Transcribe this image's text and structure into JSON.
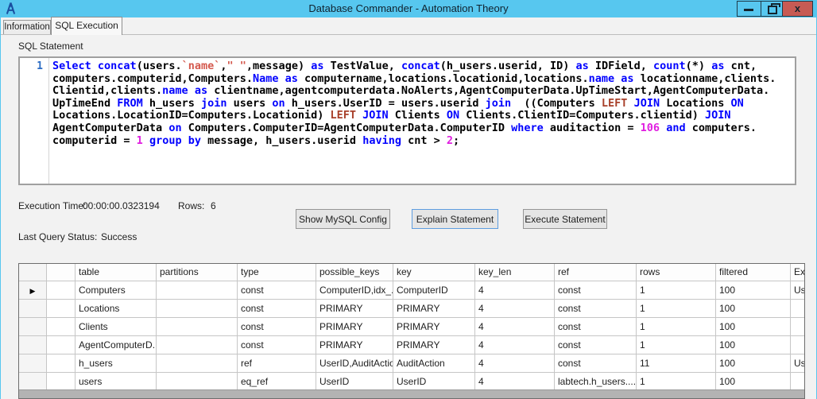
{
  "colors": {
    "titlebar": "#57c7ef",
    "close_button": "#c75b54",
    "keyword": "#0000ff",
    "string": "#d4594e",
    "number": "#e01ee0",
    "left_keyword": "#a8402a",
    "line_number": "#2b6cc4",
    "focus_border": "#5e9de0"
  },
  "window": {
    "title": "Database Commander - Automation Theory",
    "controls": {
      "minimize_icon": "—",
      "restore_icon": "❐",
      "close_icon": "x"
    }
  },
  "tabs": [
    {
      "label": "Information",
      "active": false
    },
    {
      "label": "SQL Execution",
      "active": true
    }
  ],
  "sql_editor": {
    "label": "SQL Statement",
    "line_number": "1",
    "lines": [
      [
        [
          "kw",
          "Select"
        ],
        [
          "pl",
          " "
        ],
        [
          "kw",
          "concat"
        ],
        [
          "pl",
          "(users."
        ],
        [
          "str",
          "`name`"
        ],
        [
          "pl",
          ","
        ],
        [
          "str",
          "\" \""
        ],
        [
          "pl",
          ",message) "
        ],
        [
          "kw",
          "as"
        ],
        [
          "pl",
          " TestValue, "
        ],
        [
          "kw",
          "concat"
        ],
        [
          "pl",
          "(h_users.userid, ID) "
        ],
        [
          "kw",
          "as"
        ],
        [
          "pl",
          " IDField, "
        ],
        [
          "kw",
          "count"
        ],
        [
          "pl",
          "(*) "
        ],
        [
          "kw",
          "as"
        ],
        [
          "pl",
          " cnt,"
        ]
      ],
      [
        [
          "pl",
          "computers.computerid,Computers."
        ],
        [
          "kw",
          "Name"
        ],
        [
          "pl",
          " "
        ],
        [
          "kw",
          "as"
        ],
        [
          "pl",
          " computername,locations.locationid,locations."
        ],
        [
          "kw",
          "name"
        ],
        [
          "pl",
          " "
        ],
        [
          "kw",
          "as"
        ],
        [
          "pl",
          " locationname,clients."
        ]
      ],
      [
        [
          "pl",
          "Clientid,clients."
        ],
        [
          "kw",
          "name"
        ],
        [
          "pl",
          " "
        ],
        [
          "kw",
          "as"
        ],
        [
          "pl",
          " clientname,agentcomputerdata.NoAlerts,AgentComputerData.UpTimeStart,AgentComputerData."
        ]
      ],
      [
        [
          "pl",
          "UpTimeEnd "
        ],
        [
          "kw",
          "FROM"
        ],
        [
          "pl",
          " h_users "
        ],
        [
          "kw",
          "join"
        ],
        [
          "pl",
          " users "
        ],
        [
          "kw",
          "on"
        ],
        [
          "pl",
          " h_users.UserID = users.userid "
        ],
        [
          "kw",
          "join"
        ],
        [
          "pl",
          "  ((Computers "
        ],
        [
          "lkw",
          "LEFT"
        ],
        [
          "pl",
          " "
        ],
        [
          "kw",
          "JOIN"
        ],
        [
          "pl",
          " Locations "
        ],
        [
          "kw",
          "ON"
        ]
      ],
      [
        [
          "pl",
          "Locations.LocationID=Computers.Locationid) "
        ],
        [
          "lkw",
          "LEFT"
        ],
        [
          "pl",
          " "
        ],
        [
          "kw",
          "JOIN"
        ],
        [
          "pl",
          " Clients "
        ],
        [
          "kw",
          "ON"
        ],
        [
          "pl",
          " Clients.ClientID=Computers.clientid) "
        ],
        [
          "kw",
          "JOIN"
        ]
      ],
      [
        [
          "pl",
          "AgentComputerData "
        ],
        [
          "kw",
          "on"
        ],
        [
          "pl",
          " Computers.ComputerID=AgentComputerData.ComputerID "
        ],
        [
          "kw",
          "where"
        ],
        [
          "pl",
          " auditaction = "
        ],
        [
          "num",
          "106"
        ],
        [
          "pl",
          " "
        ],
        [
          "kw",
          "and"
        ],
        [
          "pl",
          " computers."
        ]
      ],
      [
        [
          "pl",
          "computerid = "
        ],
        [
          "num",
          "1"
        ],
        [
          "pl",
          " "
        ],
        [
          "kw",
          "group by"
        ],
        [
          "pl",
          " message, h_users.userid "
        ],
        [
          "kw",
          "having"
        ],
        [
          "pl",
          " cnt > "
        ],
        [
          "num",
          "2"
        ],
        [
          "pl",
          ";"
        ]
      ]
    ]
  },
  "status": {
    "execution_time_label": "Execution Time:",
    "execution_time": "00:00:00.0323194",
    "rows_label": "Rows:",
    "rows": "6",
    "last_query_label": "Last Query Status:",
    "last_query_status": "Success"
  },
  "buttons": [
    {
      "label": "Show MySQL Config"
    },
    {
      "label": "Explain Statement"
    },
    {
      "label": "Execute Statement"
    }
  ],
  "grid": {
    "current_row_indicator": "▶",
    "columns": [
      {
        "key": "sel",
        "label": "",
        "width": 35
      },
      {
        "key": "c0",
        "label": "",
        "width": 36
      },
      {
        "key": "table",
        "label": "table",
        "width": 102
      },
      {
        "key": "partitions",
        "label": "partitions",
        "width": 102
      },
      {
        "key": "type",
        "label": "type",
        "width": 99
      },
      {
        "key": "possible_keys",
        "label": "possible_keys",
        "width": 97
      },
      {
        "key": "key",
        "label": "key",
        "width": 103
      },
      {
        "key": "key_len",
        "label": "key_len",
        "width": 100
      },
      {
        "key": "ref",
        "label": "ref",
        "width": 103
      },
      {
        "key": "rows",
        "label": "rows",
        "width": 100
      },
      {
        "key": "filtered",
        "label": "filtered",
        "width": 94
      },
      {
        "key": "extra",
        "label": "Extra",
        "width": 40
      }
    ],
    "rows": [
      {
        "c0": "",
        "table": "Computers",
        "partitions": "",
        "type": "const",
        "possible_keys": "ComputerID,idx_...",
        "key": "ComputerID",
        "key_len": "4",
        "ref": "const",
        "rows": "1",
        "filtered": "100",
        "extra": "Us..."
      },
      {
        "c0": "",
        "table": "Locations",
        "partitions": "",
        "type": "const",
        "possible_keys": "PRIMARY",
        "key": "PRIMARY",
        "key_len": "4",
        "ref": "const",
        "rows": "1",
        "filtered": "100",
        "extra": ""
      },
      {
        "c0": "",
        "table": "Clients",
        "partitions": "",
        "type": "const",
        "possible_keys": "PRIMARY",
        "key": "PRIMARY",
        "key_len": "4",
        "ref": "const",
        "rows": "1",
        "filtered": "100",
        "extra": ""
      },
      {
        "c0": "",
        "table": "AgentComputerD...",
        "partitions": "",
        "type": "const",
        "possible_keys": "PRIMARY",
        "key": "PRIMARY",
        "key_len": "4",
        "ref": "const",
        "rows": "1",
        "filtered": "100",
        "extra": ""
      },
      {
        "c0": "",
        "table": "h_users",
        "partitions": "",
        "type": "ref",
        "possible_keys": "UserID,AuditAction",
        "key": "AuditAction",
        "key_len": "4",
        "ref": "const",
        "rows": "11",
        "filtered": "100",
        "extra": "Us..."
      },
      {
        "c0": "",
        "table": "users",
        "partitions": "",
        "type": "eq_ref",
        "possible_keys": "UserID",
        "key": "UserID",
        "key_len": "4",
        "ref": "labtech.h_users....",
        "rows": "1",
        "filtered": "100",
        "extra": ""
      }
    ]
  }
}
